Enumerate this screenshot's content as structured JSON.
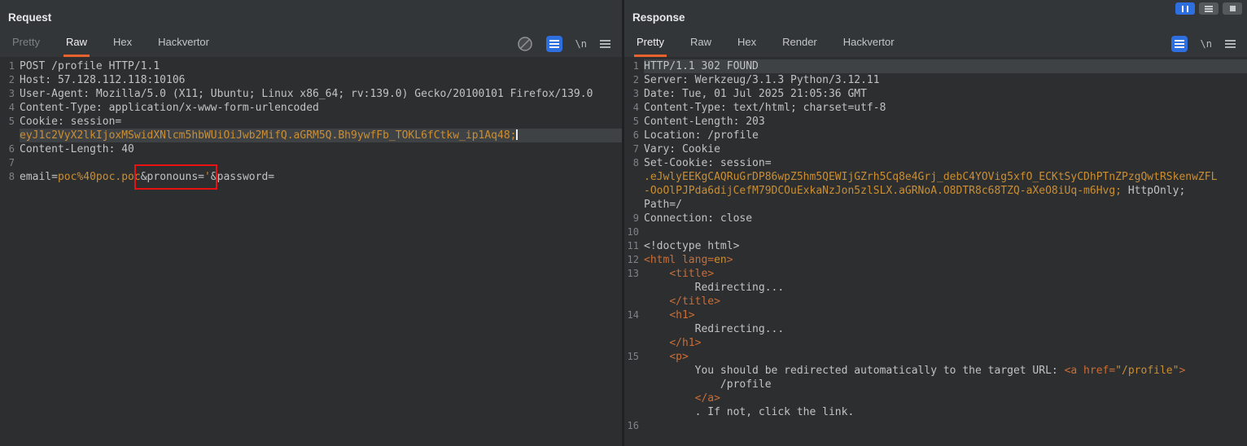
{
  "colors": {
    "accent_orange": "#e8622d",
    "accent_blue": "#2e6fe0",
    "annotation_red": "#e81212",
    "value_orange": "#cb8e32",
    "tag_orange": "#cb6d35",
    "selection_gray": "#3e4245"
  },
  "window": {
    "controls": [
      {
        "icon": "pause-icon"
      },
      {
        "icon": "menu-lines-icon"
      },
      {
        "icon": "maximize-square-icon"
      }
    ]
  },
  "request": {
    "title": "Request",
    "tabs": [
      {
        "label": "Pretty",
        "state": "dim"
      },
      {
        "label": "Raw",
        "state": "selected"
      },
      {
        "label": "Hex",
        "state": "normal"
      },
      {
        "label": "Hackvertor",
        "state": "normal"
      }
    ],
    "toolbar": {
      "icons": [
        "no-highlight-icon",
        "pretty-print-icon",
        "newline-toggle-icon",
        "editor-menu-icon"
      ],
      "newline_label": "\\n"
    },
    "lines": [
      {
        "num": "1",
        "segments": [
          {
            "text": "POST /profile HTTP/1.1",
            "style": "plain"
          }
        ]
      },
      {
        "num": "2",
        "segments": [
          {
            "text": "Host: 57.128.112.118:10106",
            "style": "plain"
          }
        ]
      },
      {
        "num": "3",
        "segments": [
          {
            "text": "User-Agent: Mozilla/5.0 (X11; Ubuntu; Linux x86_64; rv:139.0) Gecko/20100101 Firefox/139.0",
            "style": "plain"
          }
        ]
      },
      {
        "num": "4",
        "segments": [
          {
            "text": "Content-Type: application/x-www-form-urlencoded",
            "style": "plain"
          }
        ]
      },
      {
        "num": "5",
        "segments": [
          {
            "text": "Cookie: session=",
            "style": "plain"
          }
        ]
      },
      {
        "num": "",
        "selected": true,
        "cursor": true,
        "segments": [
          {
            "text": "eyJ1c2VyX2lkIjoxMSwidXNlcm5hbWUiOiJwb2MifQ.aGRM5Q.Bh9ywfFb_TOKL6fCtkw_ip1Aq48;",
            "style": "val"
          }
        ]
      },
      {
        "num": "6",
        "segments": [
          {
            "text": "Content-Length: 40",
            "style": "plain"
          }
        ]
      },
      {
        "num": "7",
        "segments": []
      },
      {
        "num": "8",
        "segments": [
          {
            "text": "email=",
            "style": "plain"
          },
          {
            "text": "poc%40poc.poc",
            "style": "val"
          },
          {
            "text": "&pronouns=",
            "style": "plain",
            "box": true
          },
          {
            "text": "'",
            "style": "val",
            "box": true
          },
          {
            "text": "&password=",
            "style": "plain"
          }
        ]
      }
    ]
  },
  "response": {
    "title": "Response",
    "tabs": [
      {
        "label": "Pretty",
        "state": "selected"
      },
      {
        "label": "Raw",
        "state": "normal"
      },
      {
        "label": "Hex",
        "state": "normal"
      },
      {
        "label": "Render",
        "state": "normal"
      },
      {
        "label": "Hackvertor",
        "state": "normal"
      }
    ],
    "toolbar": {
      "icons": [
        "pretty-print-icon",
        "newline-toggle-icon",
        "editor-menu-icon"
      ],
      "newline_label": "\\n"
    },
    "lines": [
      {
        "num": "1",
        "selected": true,
        "segments": [
          {
            "text": "HTTP/1.1 302 FOUND",
            "style": "plain"
          }
        ]
      },
      {
        "num": "2",
        "segments": [
          {
            "text": "Server: Werkzeug/3.1.3 Python/3.12.11",
            "style": "plain"
          }
        ]
      },
      {
        "num": "3",
        "segments": [
          {
            "text": "Date: Tue, 01 Jul 2025 21:05:36 GMT",
            "style": "plain"
          }
        ]
      },
      {
        "num": "4",
        "segments": [
          {
            "text": "Content-Type: text/html; charset=utf-8",
            "style": "plain"
          }
        ]
      },
      {
        "num": "5",
        "segments": [
          {
            "text": "Content-Length: 203",
            "style": "plain"
          }
        ]
      },
      {
        "num": "6",
        "segments": [
          {
            "text": "Location: /profile",
            "style": "plain"
          }
        ]
      },
      {
        "num": "7",
        "segments": [
          {
            "text": "Vary: Cookie",
            "style": "plain"
          }
        ]
      },
      {
        "num": "8",
        "segments": [
          {
            "text": "Set-Cookie: session=",
            "style": "plain"
          }
        ]
      },
      {
        "num": "",
        "segments": [
          {
            "text": ".eJwlyEEKgCAQRuGrDP86wpZ5hm5QEWIjGZrh5Cq8e4Grj_debC4YOVig5xfO_ECKtSyCDhPTnZPzgQwtRSkenwZFL",
            "style": "val"
          }
        ]
      },
      {
        "num": "",
        "segments": [
          {
            "text": "-OoOlPJPda6dijCefM79DCOuExkaNzJon5zlSLX.aGRNoA.O8DTR8c68TZQ-aXeO8iUq-m6Hvg;",
            "style": "val"
          },
          {
            "text": " HttpOnly;",
            "style": "plain"
          }
        ]
      },
      {
        "num": "",
        "segments": [
          {
            "text": "Path=/",
            "style": "plain"
          }
        ]
      },
      {
        "num": "9",
        "segments": [
          {
            "text": "Connection: close",
            "style": "plain"
          }
        ]
      },
      {
        "num": "10",
        "segments": []
      },
      {
        "num": "11",
        "segments": [
          {
            "text": "<!doctype html>",
            "style": "plain"
          }
        ]
      },
      {
        "num": "12",
        "segments": [
          {
            "text": "<html",
            "style": "tag"
          },
          {
            "text": " lang=",
            "style": "tag"
          },
          {
            "text": "en",
            "style": "val"
          },
          {
            "text": ">",
            "style": "tag"
          }
        ]
      },
      {
        "num": "13",
        "segments": [
          {
            "text": "    ",
            "style": "plain"
          },
          {
            "text": "<title>",
            "style": "tag"
          }
        ]
      },
      {
        "num": "",
        "segments": [
          {
            "text": "        Redirecting...",
            "style": "plain"
          }
        ]
      },
      {
        "num": "",
        "segments": [
          {
            "text": "    ",
            "style": "plain"
          },
          {
            "text": "</title>",
            "style": "tag"
          }
        ]
      },
      {
        "num": "14",
        "segments": [
          {
            "text": "    ",
            "style": "plain"
          },
          {
            "text": "<h1>",
            "style": "tag"
          }
        ]
      },
      {
        "num": "",
        "segments": [
          {
            "text": "        Redirecting...",
            "style": "plain"
          }
        ]
      },
      {
        "num": "",
        "segments": [
          {
            "text": "    ",
            "style": "plain"
          },
          {
            "text": "</h1>",
            "style": "tag"
          }
        ]
      },
      {
        "num": "15",
        "segments": [
          {
            "text": "    ",
            "style": "plain"
          },
          {
            "text": "<p>",
            "style": "tag"
          }
        ]
      },
      {
        "num": "",
        "segments": [
          {
            "text": "        You should be redirected automatically to the target URL: ",
            "style": "plain"
          },
          {
            "text": "<a",
            "style": "tag"
          },
          {
            "text": " href=",
            "style": "tag"
          },
          {
            "text": "\"/profile\"",
            "style": "val"
          },
          {
            "text": ">",
            "style": "tag"
          }
        ]
      },
      {
        "num": "",
        "segments": [
          {
            "text": "            /profile",
            "style": "plain"
          }
        ]
      },
      {
        "num": "",
        "segments": [
          {
            "text": "        ",
            "style": "plain"
          },
          {
            "text": "</a>",
            "style": "tag"
          }
        ]
      },
      {
        "num": "",
        "segments": [
          {
            "text": "        . If not, click the link.",
            "style": "plain"
          }
        ]
      },
      {
        "num": "16",
        "segments": []
      }
    ]
  }
}
